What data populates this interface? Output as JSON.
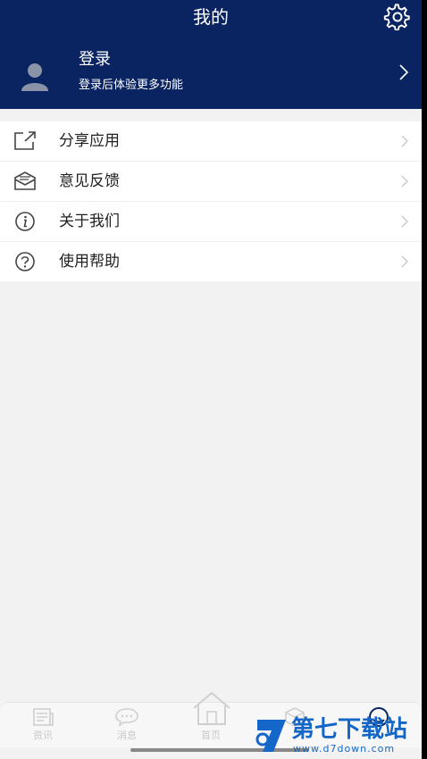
{
  "header": {
    "title": "我的",
    "settings_icon": "gear-icon"
  },
  "login": {
    "title": "登录",
    "subtitle": "登录后体验更多功能",
    "avatar_icon": "person-silhouette-icon"
  },
  "menu": {
    "items": [
      {
        "label": "分享应用",
        "icon": "share-icon"
      },
      {
        "label": "意见反馈",
        "icon": "mail-icon"
      },
      {
        "label": "关于我们",
        "icon": "info-icon"
      },
      {
        "label": "使用帮助",
        "icon": "help-icon"
      }
    ]
  },
  "tabbar": {
    "tabs": [
      {
        "label": "资讯",
        "icon": "news-icon"
      },
      {
        "label": "消息",
        "icon": "chat-icon"
      },
      {
        "label": "首页",
        "icon": "home-icon"
      },
      {
        "label": "",
        "icon": "cube-icon"
      },
      {
        "label": "",
        "icon": "profile-icon"
      }
    ]
  },
  "watermark": {
    "text": "第七下载站",
    "url": "www.d7down.com"
  },
  "colors": {
    "header_bg": "#0a2462",
    "page_bg": "#f2f2f2",
    "watermark": "#1467c8"
  }
}
